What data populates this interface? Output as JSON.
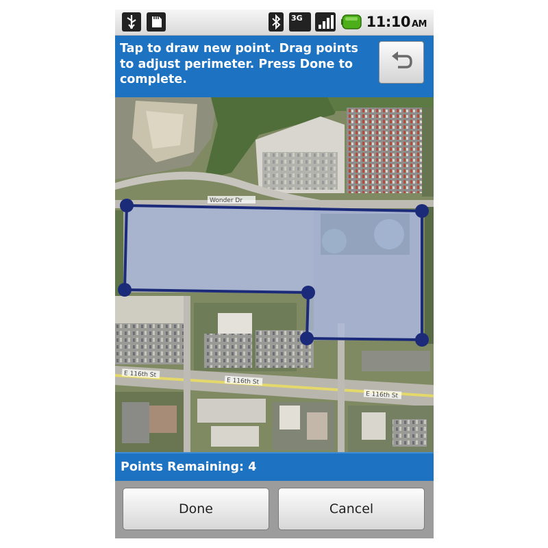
{
  "status_bar": {
    "time": "11:10",
    "am_pm": "AM",
    "network_label": "3G",
    "icons": [
      "usb-icon",
      "sd-card-icon",
      "bluetooth-icon",
      "network-3g-icon",
      "signal-icon",
      "battery-icon"
    ],
    "battery_color": "#4caf1a"
  },
  "instructions": {
    "text": "Tap to draw new point. Drag points to adjust perimeter. Press Done to complete.",
    "undo_icon": "undo-arrow-icon"
  },
  "map": {
    "road_labels": [
      "Wonder Dr",
      "E 116th St",
      "E 116th St"
    ],
    "perimeter_color": "#1c2a7a",
    "perimeter_point_count": 6
  },
  "footer": {
    "points_remaining": "Points Remaining: 4",
    "done_label": "Done",
    "cancel_label": "Cancel"
  },
  "colors": {
    "accent_blue": "#1d73c2",
    "button_area": "#9c9c9c"
  }
}
